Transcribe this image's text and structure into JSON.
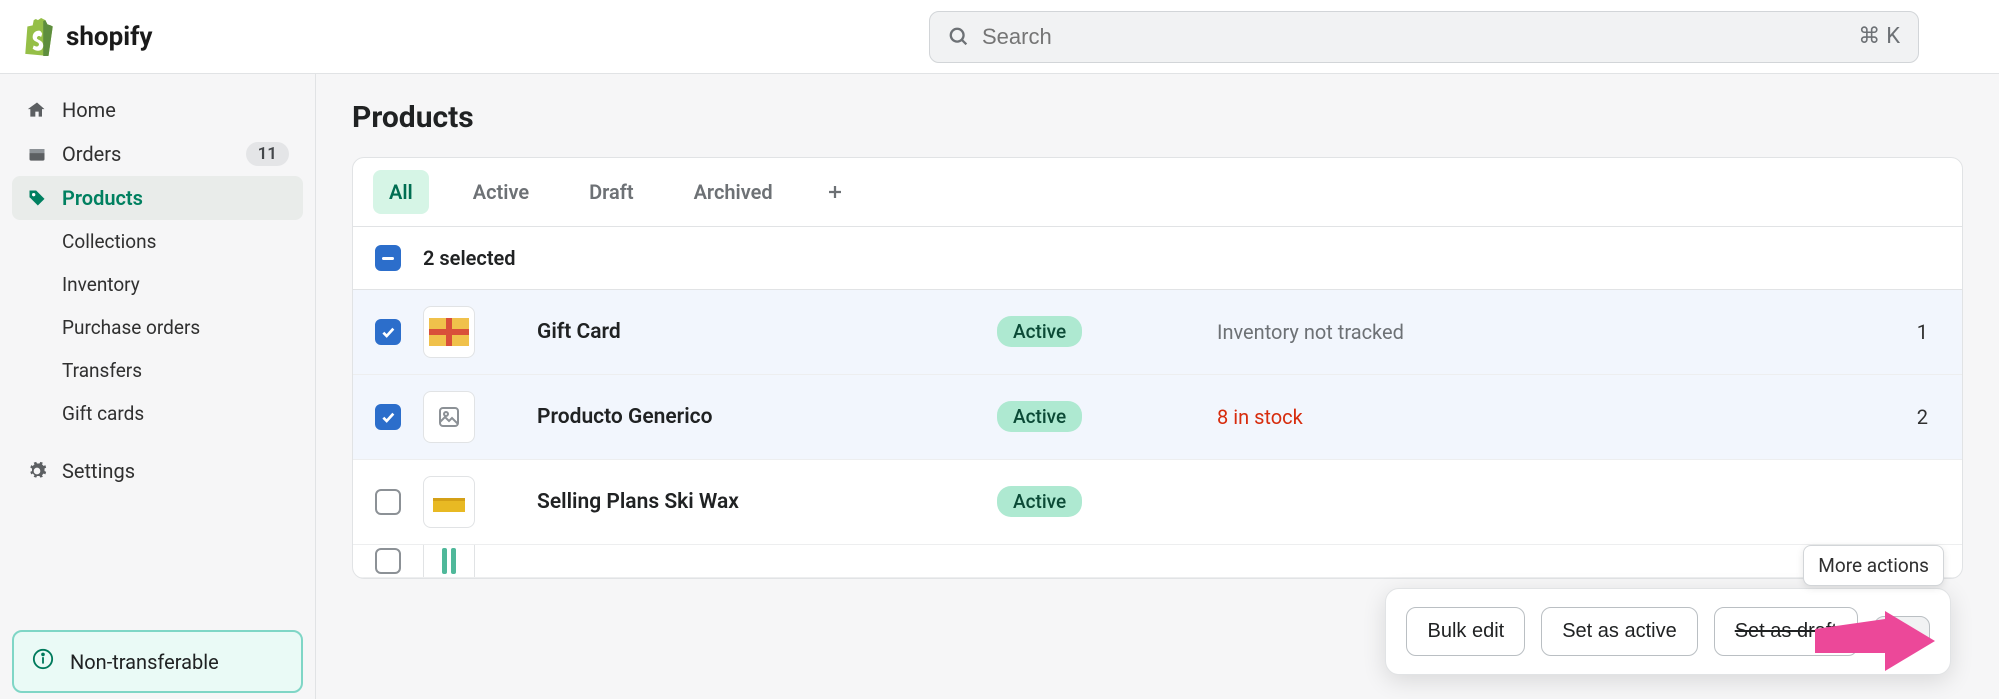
{
  "brand": "shopify",
  "search": {
    "placeholder": "Search",
    "shortcut_mod": "⌘",
    "shortcut_key": "K"
  },
  "sidebar": {
    "items": [
      {
        "label": "Home"
      },
      {
        "label": "Orders",
        "badge": "11"
      },
      {
        "label": "Products"
      },
      {
        "label": "Collections"
      },
      {
        "label": "Inventory"
      },
      {
        "label": "Purchase orders"
      },
      {
        "label": "Transfers"
      },
      {
        "label": "Gift cards"
      }
    ],
    "settings_label": "Settings",
    "callout_text": "Non-transferable"
  },
  "page": {
    "title": "Products"
  },
  "tabs": [
    {
      "label": "All"
    },
    {
      "label": "Active"
    },
    {
      "label": "Draft"
    },
    {
      "label": "Archived"
    }
  ],
  "selection_text": "2 selected",
  "rows": [
    {
      "name": "Gift Card",
      "status": "Active",
      "inventory": "Inventory not tracked",
      "inv_warn": false,
      "qty": "1",
      "checked": true
    },
    {
      "name": "Producto Generico",
      "status": "Active",
      "inventory": "8 in stock",
      "inv_warn": true,
      "qty": "2",
      "checked": true
    },
    {
      "name": "Selling Plans Ski Wax",
      "status": "Active",
      "inventory": "",
      "inv_warn": false,
      "qty": "",
      "checked": false
    }
  ],
  "actionbar": {
    "bulk_edit": "Bulk edit",
    "set_active": "Set as active",
    "struck": "Set as draft",
    "tooltip": "More actions"
  }
}
